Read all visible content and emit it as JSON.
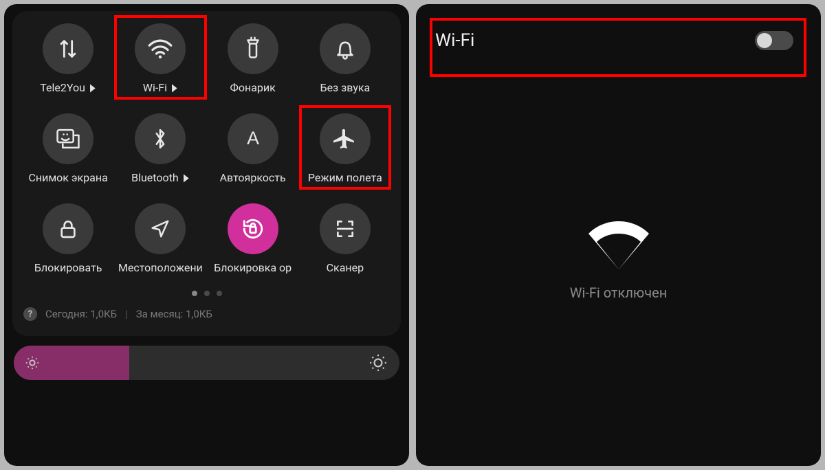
{
  "left": {
    "tiles": [
      {
        "label": "Tele2You",
        "expand": true,
        "active": false,
        "icon": "data-transfer"
      },
      {
        "label": "Wi-Fi",
        "expand": true,
        "active": false,
        "icon": "wifi",
        "hl": true
      },
      {
        "label": "Фонарик",
        "expand": false,
        "active": false,
        "icon": "flashlight"
      },
      {
        "label": "Без звука",
        "expand": false,
        "active": false,
        "icon": "bell"
      },
      {
        "label": "Снимок экрана",
        "expand": false,
        "active": false,
        "icon": "screenshot"
      },
      {
        "label": "Bluetooth",
        "expand": true,
        "active": false,
        "icon": "bluetooth"
      },
      {
        "label": "Автояркость",
        "expand": false,
        "active": false,
        "icon": "auto-bright"
      },
      {
        "label": "Режим полета",
        "expand": false,
        "active": false,
        "icon": "airplane",
        "hl": true
      },
      {
        "label": "Блокировать",
        "expand": false,
        "active": false,
        "icon": "lock"
      },
      {
        "label": "Местоположени",
        "expand": false,
        "active": false,
        "icon": "location"
      },
      {
        "label": "Блокировка ор",
        "expand": false,
        "active": true,
        "icon": "rotate-lock"
      },
      {
        "label": "Сканер",
        "expand": false,
        "active": false,
        "icon": "scanner"
      }
    ],
    "pager": {
      "count": 3,
      "active": 0
    },
    "usage": {
      "today_label": "Сегодня: 1,0КБ",
      "month_label": "За месяц: 1,0КБ"
    },
    "brightness_pct": 30
  },
  "right": {
    "title": "Wi-Fi",
    "toggle_on": false,
    "status_text": "Wi-Fi отключен"
  },
  "colors": {
    "accent": "#d12f9b",
    "highlight": "#ff0000"
  }
}
